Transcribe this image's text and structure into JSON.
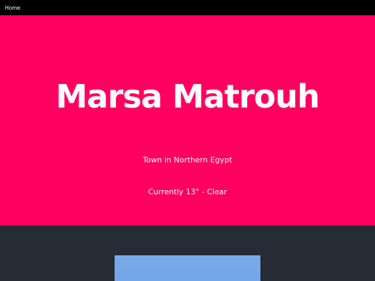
{
  "nav": {
    "home_label": "Home"
  },
  "hero": {
    "title": "Marsa Matrouh",
    "subtitle": "Town in Northern Egypt",
    "weather": "Currently 13° - Clear"
  },
  "colors": {
    "hero_background": "#ff0060",
    "topbar_background": "#000000",
    "content_background": "#252c36",
    "image_sky": "#75a8ea"
  }
}
